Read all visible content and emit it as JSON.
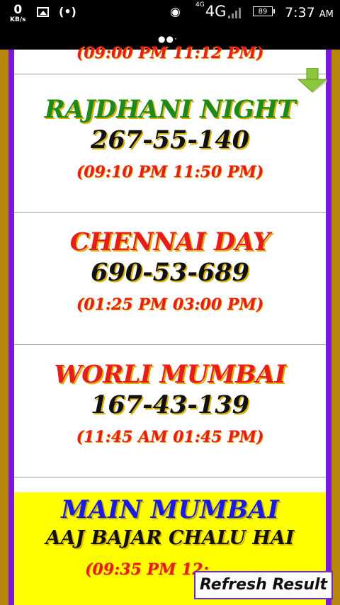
{
  "status_bar": {
    "speed_value": "0",
    "speed_unit": "KB/s",
    "network_small": "4G",
    "network": "4G",
    "battery": "89",
    "time": "7:37",
    "ampm": "AM",
    "icons": [
      "image-icon",
      "radio-icon",
      "hotspot-icon",
      "signal-icon",
      "battery-icon"
    ]
  },
  "top_partial": {
    "time": "(09:00 PM 11:12 PM)"
  },
  "markets": [
    {
      "name": "RAJDHANI NIGHT",
      "number": "267-55-140",
      "time": "(09:10 PM 11:50 PM)",
      "name_color": "#1c8a1c"
    },
    {
      "name": "CHENNAI DAY",
      "number": "690-53-689",
      "time": "(01:25 PM 03:00 PM)",
      "name_color": "#e81c1c"
    },
    {
      "name": "WORLI MUMBAI",
      "number": "167-43-139",
      "time": "(11:45 AM 01:45 PM)",
      "name_color": "#e81c1c"
    }
  ],
  "main_market": {
    "name": "MAIN MUMBAI",
    "subtitle": "AAJ BAJAR CHALU HAI",
    "time": "(09:35 PM 12:",
    "background": "#ffff00"
  },
  "refresh_label": "Refresh Result",
  "colors": {
    "purple_border": "#7a17d8",
    "gold_border": "#b8860b"
  }
}
